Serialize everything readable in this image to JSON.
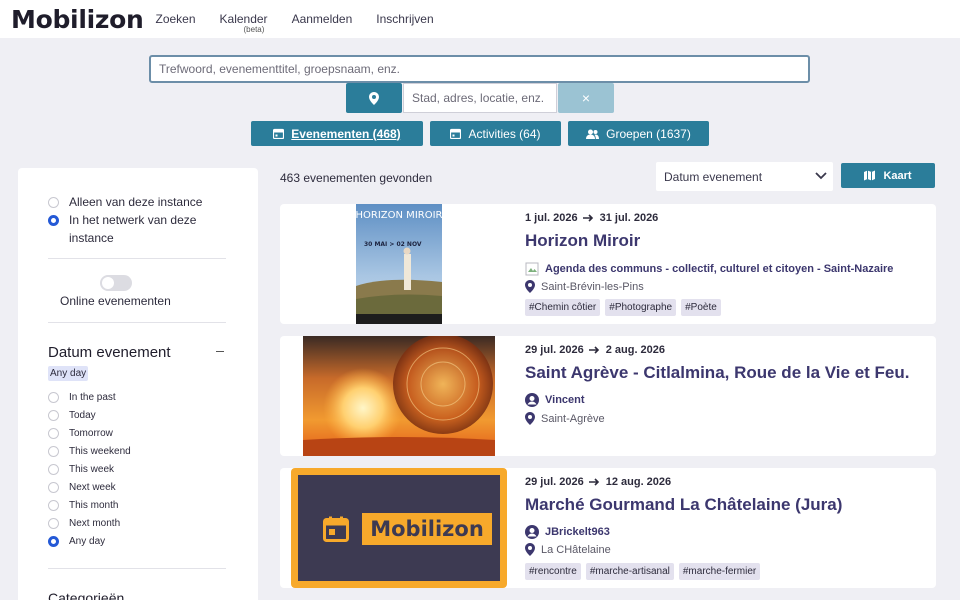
{
  "brand": {
    "logo": "Mobilizon"
  },
  "nav": {
    "search": "Zoeken",
    "calendar": "Kalender",
    "calendar_badge": "(beta)",
    "login": "Aanmelden",
    "register": "Inschrijven"
  },
  "search": {
    "placeholder": "Trefwoord, evenementtitel, groepsnaam, enz.",
    "location_placeholder": "Stad, adres, locatie, enz.",
    "clear": "×"
  },
  "tabs": [
    {
      "label": "Evenementen (468)",
      "active": true,
      "icon": "calendar-icon"
    },
    {
      "label": "Activities (64)",
      "active": false,
      "icon": "calendar-icon"
    },
    {
      "label": "Groepen (1637)",
      "active": false,
      "icon": "people-icon"
    }
  ],
  "filters": {
    "scope": [
      {
        "label": "Alleen van deze instance",
        "selected": false
      },
      {
        "label": "In het netwerk van deze instance",
        "selected": true
      }
    ],
    "online_label": "Online evenementen",
    "online_enabled": false,
    "date": {
      "title": "Datum evenement",
      "selected": "Any day",
      "options": [
        "In the past",
        "Today",
        "Tomorrow",
        "This weekend",
        "This week",
        "Next week",
        "This month",
        "Next month",
        "Any day"
      ]
    },
    "categories_title": "Categorieën"
  },
  "results": {
    "count_text": "463 evenementen gevonden",
    "sort_value": "Datum evenement",
    "map_button": "Kaart"
  },
  "events": [
    {
      "start": "1 jul. 2026",
      "end": "31 jul. 2026",
      "title": "Horizon Miroir",
      "organizer": "Agenda des communs - collectif, culturel et citoyen - Saint-Nazaire",
      "location": "Saint-Brévin-les-Pins",
      "tags": [
        "#Chemin côtier",
        "#Photographe",
        "#Poète"
      ],
      "poster_title": "HORIZON MIROIR",
      "poster_dates": "30 MAI > 02 NOV"
    },
    {
      "start": "29 jul. 2026",
      "end": "2 aug. 2026",
      "title": "Saint Agrève - Citlalmina, Roue de la Vie et Feu.",
      "organizer": "Vincent",
      "location": "Saint-Agrève",
      "tags": []
    },
    {
      "start": "29 jul. 2026",
      "end": "12 aug. 2026",
      "title": "Marché Gourmand La Châtelaine (Jura)",
      "organizer": "JBrickelt963",
      "location": "La CHâtelaine",
      "tags": [
        "#rencontre",
        "#marche-artisanal",
        "#marche-fermier"
      ],
      "placeholder_logo": "Mobilizon"
    }
  ],
  "colors": {
    "primary": "#2b7d9a",
    "title": "#3c376e",
    "background": "#efeff4"
  }
}
